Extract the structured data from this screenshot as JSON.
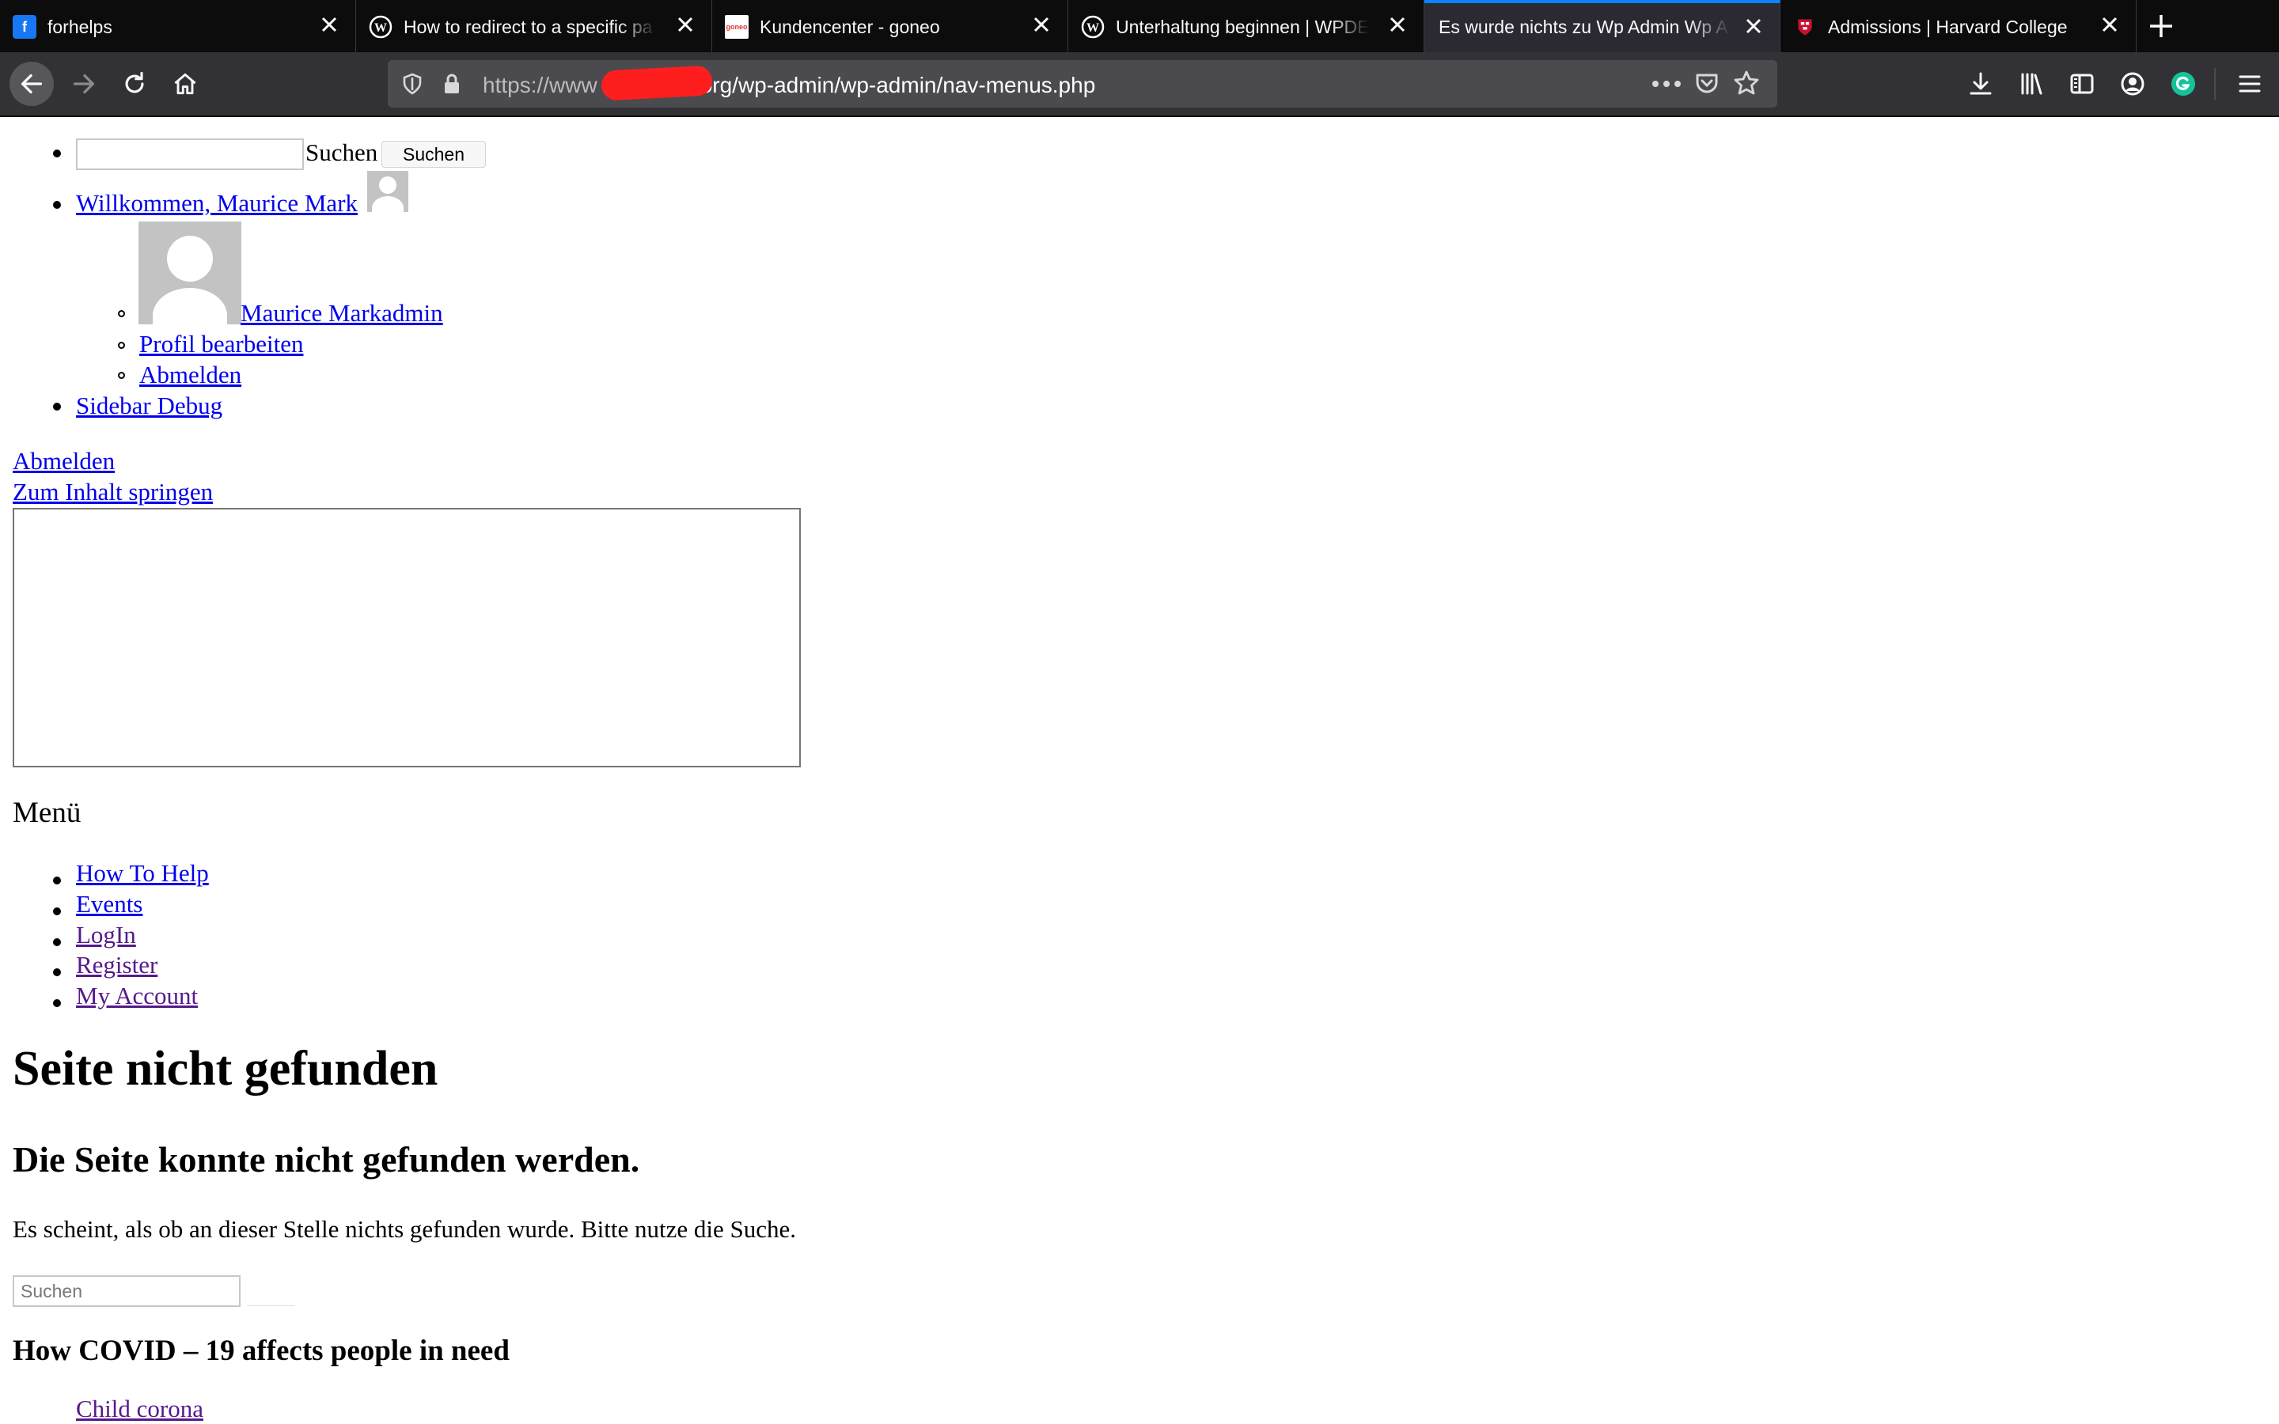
{
  "browser": {
    "tabs": [
      {
        "title": "forhelps",
        "favicon": "facebook-icon",
        "active": false
      },
      {
        "title": "How to redirect to a specific pa",
        "favicon": "wordpress-icon",
        "active": false
      },
      {
        "title": "Kundencenter - goneo",
        "favicon": "goneo-icon",
        "active": false
      },
      {
        "title": "Unterhaltung beginnen | WPDE",
        "favicon": "wordpress-icon",
        "active": false
      },
      {
        "title": "Es wurde nichts zu Wp Admin Wp A",
        "favicon": "none",
        "active": true
      },
      {
        "title": "Admissions | Harvard College",
        "favicon": "harvard-shield-icon",
        "active": false
      }
    ],
    "url_prefix": "https://www",
    "url_suffix": "org/wp-admin/wp-admin/nav-menus.php",
    "accent_color": "#0a84ff"
  },
  "adminbar": {
    "search_label": "Suchen",
    "search_button": "Suchen",
    "welcome": "Willkommen, Maurice Mark",
    "user_name": "Maurice Markadmin",
    "edit_profile": "Profil bearbeiten",
    "logout": "Abmelden",
    "sidebar_debug": "Sidebar Debug"
  },
  "links": {
    "logout": "Abmelden",
    "skip": "Zum Inhalt springen"
  },
  "menu": {
    "title": "Menü",
    "items": [
      "How To Help",
      "Events",
      "LogIn",
      "Register",
      "My Account"
    ]
  },
  "content": {
    "h1": "Seite nicht gefunden",
    "h2": "Die Seite konnte nicht gefunden werden.",
    "text": "Es scheint, als ob an dieser Stelle nichts gefunden wurde. Bitte nutze die Suche.",
    "search_placeholder": "Suchen",
    "h3": "How COVID – 19 affects people in need",
    "post_link": "Child corona"
  }
}
